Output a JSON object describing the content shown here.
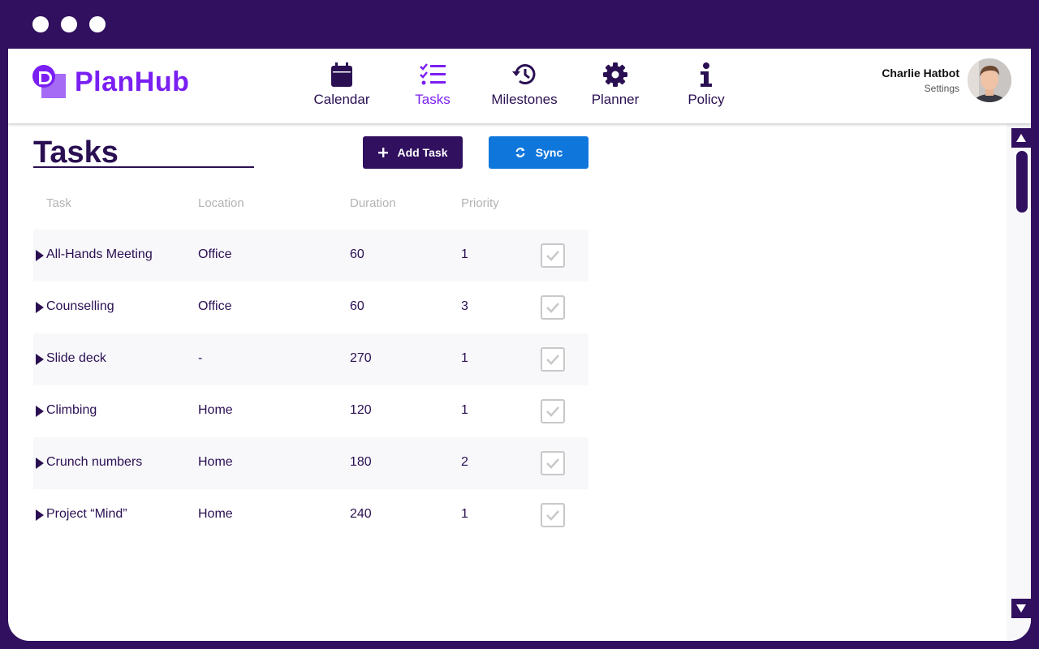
{
  "app": {
    "name": "PlanHub",
    "colors": {
      "brand": "#7a1ff2",
      "dark": "#30105f",
      "text": "#2a0f52",
      "sync": "#0f76dc"
    }
  },
  "nav": {
    "items": [
      {
        "label": "Calendar",
        "icon": "calendar-icon",
        "active": false
      },
      {
        "label": "Tasks",
        "icon": "checklist-icon",
        "active": true
      },
      {
        "label": "Milestones",
        "icon": "history-icon",
        "active": false
      },
      {
        "label": "Planner",
        "icon": "gear-icon",
        "active": false
      },
      {
        "label": "Policy",
        "icon": "info-icon",
        "active": false
      }
    ]
  },
  "user": {
    "name": "Charlie Hatbot",
    "link": "Settings"
  },
  "page": {
    "title": "Tasks"
  },
  "toolbar": {
    "add_label": "Add Task",
    "sync_label": "Sync"
  },
  "table": {
    "columns": [
      "Task",
      "Location",
      "Duration",
      "Priority"
    ],
    "rows": [
      {
        "task": "All-Hands Meeting",
        "location": "Office",
        "duration": "60",
        "priority": "1"
      },
      {
        "task": "Counselling",
        "location": "Office",
        "duration": "60",
        "priority": "3"
      },
      {
        "task": "Slide deck",
        "location": "-",
        "duration": "270",
        "priority": "1"
      },
      {
        "task": "Climbing",
        "location": "Home",
        "duration": "120",
        "priority": "1"
      },
      {
        "task": "Crunch numbers",
        "location": "Home",
        "duration": "180",
        "priority": "2"
      },
      {
        "task": "Project “Mind”",
        "location": "Home",
        "duration": "240",
        "priority": "1"
      }
    ]
  }
}
